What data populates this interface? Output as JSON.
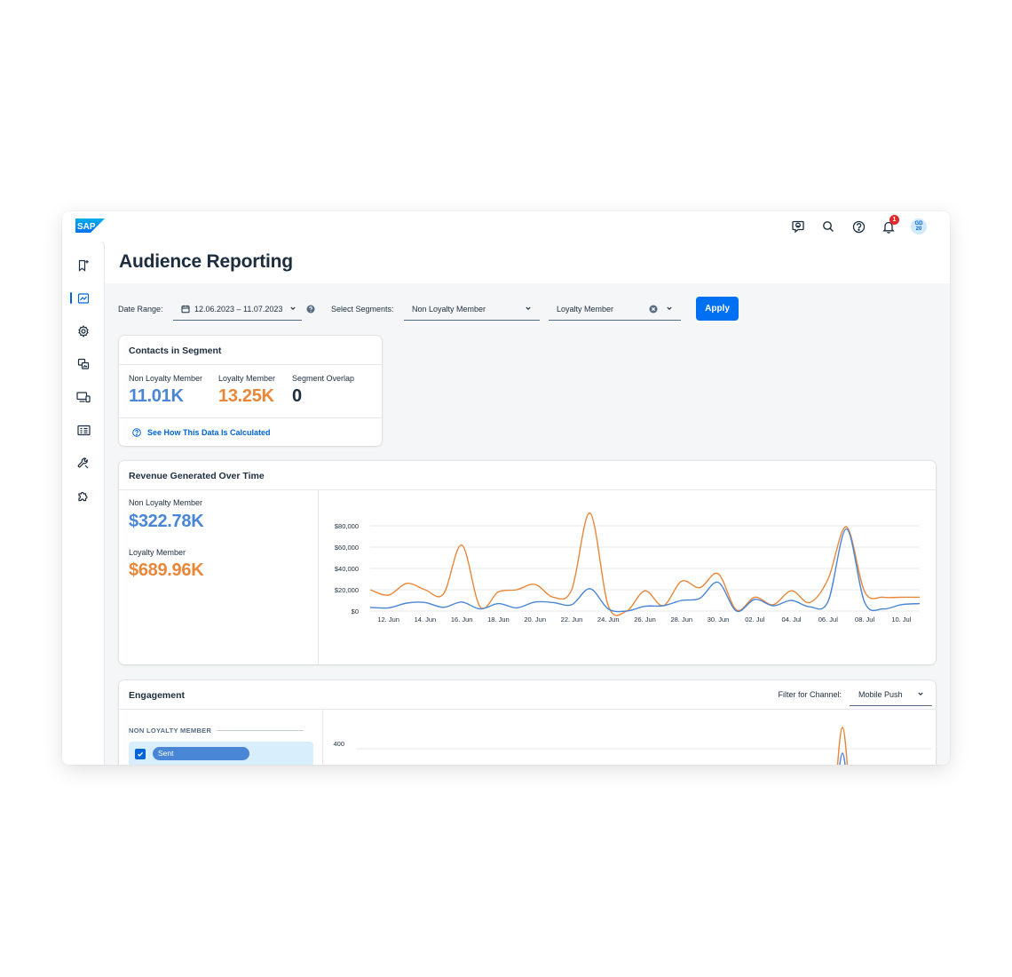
{
  "brand": {
    "logo_text": "SAP"
  },
  "page": {
    "title": "Audience Reporting"
  },
  "topbar": {
    "icons": [
      "feedback-icon",
      "search-icon",
      "help-icon",
      "bell-icon"
    ],
    "notification_count": "1",
    "avatar_line1": "GD",
    "avatar_line2": "20"
  },
  "sidebar": {
    "items": [
      "bookmark-icon",
      "analytics-icon",
      "settings-icon",
      "images-icon",
      "devices-icon",
      "contacts-icon",
      "wrench-icon",
      "puzzle-icon"
    ],
    "active_index": 1
  },
  "filters": {
    "date_label": "Date Range:",
    "date_value": "12.06.2023 – 11.07.2023",
    "segments_label": "Select Segments:",
    "segment1": "Non Loyalty Member",
    "segment2": "Loyalty Member",
    "apply_label": "Apply"
  },
  "contacts": {
    "title": "Contacts in Segment",
    "stats": [
      {
        "label": "Non Loyalty Member",
        "value": "11.01K"
      },
      {
        "label": "Loyalty Member",
        "value": "13.25K"
      },
      {
        "label": "Segment Overlap",
        "value": "0"
      }
    ],
    "link": "See How This Data Is Calculated"
  },
  "revenue": {
    "title": "Revenue Generated Over Time",
    "stats": [
      {
        "label": "Non Loyalty Member",
        "value": "$322.78K"
      },
      {
        "label": "Loyalty Member",
        "value": "$689.96K"
      }
    ]
  },
  "engagement": {
    "title": "Engagement",
    "channel_label": "Filter for Channel:",
    "channel_value": "Mobile Push",
    "section": "NON LOYALTY MEMBER",
    "metric": "Sent"
  },
  "colors": {
    "blue": "#4a86d6",
    "orange": "#e8873a",
    "accent": "#0070f2"
  },
  "chart_data": [
    {
      "type": "line",
      "x": [
        "11. Jun",
        "12. Jun",
        "13. Jun",
        "14. Jun",
        "15. Jun",
        "16. Jun",
        "17. Jun",
        "18. Jun",
        "19. Jun",
        "20. Jun",
        "21. Jun",
        "22. Jun",
        "23. Jun",
        "24. Jun",
        "25. Jun",
        "26. Jun",
        "27. Jun",
        "28. Jun",
        "29. Jun",
        "30. Jun",
        "01. Jul",
        "02. Jul",
        "03. Jul",
        "04. Jul",
        "05. Jul",
        "06. Jul",
        "07. Jul",
        "08. Jul",
        "09. Jul",
        "10. Jul",
        "11. Jul"
      ],
      "xticks": [
        "12. Jun",
        "14. Jun",
        "16. Jun",
        "18. Jun",
        "20. Jun",
        "22. Jun",
        "24. Jun",
        "26. Jun",
        "28. Jun",
        "30. Jun",
        "02. Jul",
        "04. Jul",
        "06. Jul",
        "08. Jul",
        "10. Jul"
      ],
      "yticks": [
        "$0",
        "$20,000",
        "$40,000",
        "$60,000",
        "$80,000"
      ],
      "ylim": [
        0,
        80000
      ],
      "grid": true,
      "series": [
        {
          "name": "Loyalty Member",
          "color": "#e8873a",
          "values": [
            20000,
            15000,
            26000,
            20000,
            16000,
            62000,
            4000,
            18000,
            20000,
            25000,
            13000,
            20000,
            92000,
            5000,
            0,
            19000,
            5000,
            28000,
            22000,
            35000,
            1000,
            13000,
            6000,
            19000,
            8000,
            30000,
            79000,
            18000,
            13000,
            13000,
            13000
          ]
        },
        {
          "name": "Non Loyalty Member",
          "color": "#4a86d6",
          "values": [
            3500,
            3000,
            7500,
            8000,
            3500,
            8500,
            2000,
            7000,
            3000,
            8500,
            8000,
            6000,
            21000,
            2000,
            0,
            4500,
            5000,
            10000,
            12000,
            27000,
            0,
            11000,
            5000,
            10000,
            4000,
            9000,
            77000,
            8000,
            2000,
            6000,
            7000
          ]
        }
      ]
    },
    {
      "type": "line",
      "yticks": [
        "400"
      ],
      "series": [
        {
          "name": "Loyalty Member",
          "color": "#e8873a"
        },
        {
          "name": "Non Loyalty Member",
          "color": "#4a86d6"
        }
      ]
    }
  ]
}
